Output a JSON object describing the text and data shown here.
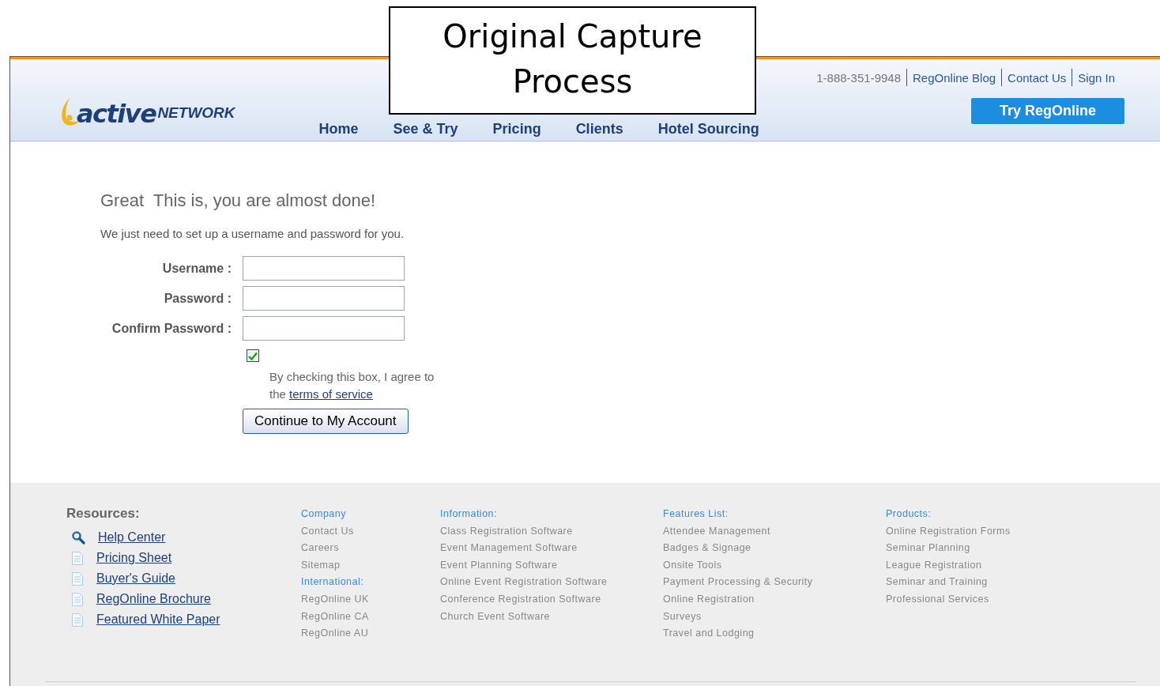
{
  "overlay": {
    "title": "Original Capture Process"
  },
  "header": {
    "logo": {
      "main": "active",
      "sub": "NETWORK"
    },
    "top_links": [
      {
        "text": "1-888-351-9948",
        "kind": "phone"
      },
      {
        "text": "RegOnline Blog",
        "kind": "link"
      },
      {
        "text": "Contact Us",
        "kind": "link"
      },
      {
        "text": "Sign In",
        "kind": "link"
      }
    ],
    "cta_button": "Try RegOnline",
    "nav": [
      "Home",
      "See & Try",
      "Pricing",
      "Clients",
      "Hotel Sourcing"
    ]
  },
  "main": {
    "heading": "Great  This is, you are almost done!",
    "intro": "We just need to set up a username and password for you.",
    "fields": [
      {
        "label": "Username :"
      },
      {
        "label": "Password :"
      },
      {
        "label": "Confirm Password :"
      }
    ],
    "agree": {
      "checked": true,
      "text": "By checking this box, I agree to the ",
      "link": "terms of service"
    },
    "submit_button": "Continue to My Account"
  },
  "footer": {
    "resources": {
      "heading": "Resources:",
      "items": [
        {
          "text": "Help Center",
          "kind": "search"
        },
        {
          "text": "Pricing Sheet",
          "kind": "doc"
        },
        {
          "text": "Buyer's Guide",
          "kind": "doc"
        },
        {
          "text": "RegOnline Brochure",
          "kind": "doc"
        },
        {
          "text": "Featured White Paper",
          "kind": "doc"
        }
      ]
    },
    "columns": [
      [
        {
          "heading": "Company",
          "items": [
            "Contact Us",
            "Careers",
            "Sitemap"
          ]
        },
        {
          "heading": "International:",
          "items": [
            "RegOnline UK",
            "RegOnline CA",
            "RegOnline AU"
          ]
        }
      ],
      [
        {
          "heading": "Information:",
          "items": [
            "Class Registration Software",
            "Event Management Software",
            "Event Planning Software",
            "Online Event Registration Software",
            "Conference Registration Software",
            "Church Event Software"
          ]
        }
      ],
      [
        {
          "heading": "Features List:",
          "items": [
            "Attendee Management",
            "Badges & Signage",
            "Onsite Tools",
            "Payment Processing & Security",
            "Online Registration",
            "Surveys",
            "Travel and Lodging"
          ]
        }
      ],
      [
        {
          "heading": "Products:",
          "items": [
            "Online Registration Forms",
            "Seminar Planning",
            "League Registration",
            "Seminar and Training",
            "Professional Services"
          ]
        }
      ]
    ]
  }
}
